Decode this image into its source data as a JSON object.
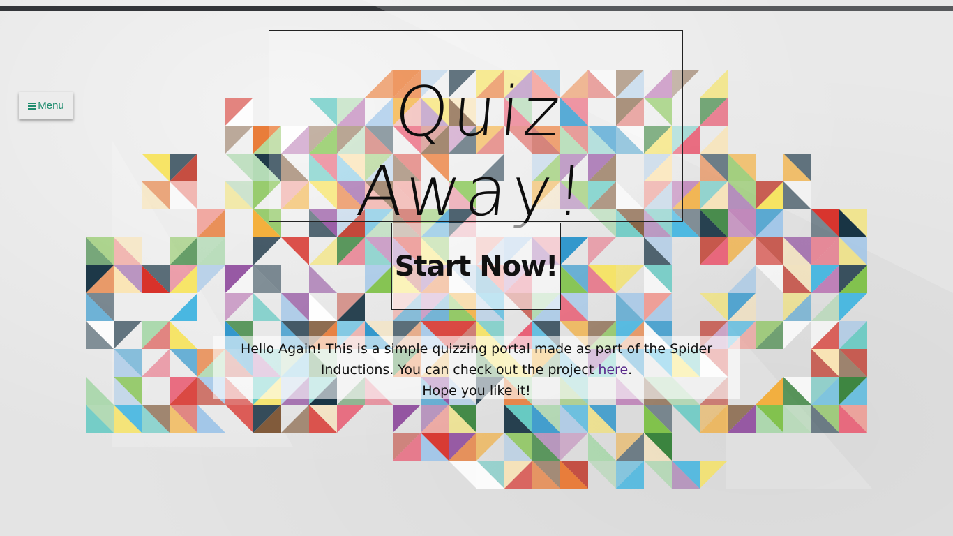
{
  "header": {
    "menu_label": "Menu",
    "menu_icon": "hamburger-icon"
  },
  "hero": {
    "title": "Quiz Away!",
    "start_label": "Start Now!"
  },
  "intro": {
    "text_before_link": "Hello Again! This is a simple quizzing portal made as part of the Spider Inductions. You can check out the project ",
    "link_text": "here",
    "text_after_link": ".",
    "closing": "Hope you like it!"
  },
  "colors": {
    "top_bar": "#333539",
    "menu_accent": "#1e8c6e",
    "link": "#5a2a8c",
    "text": "#111111"
  }
}
